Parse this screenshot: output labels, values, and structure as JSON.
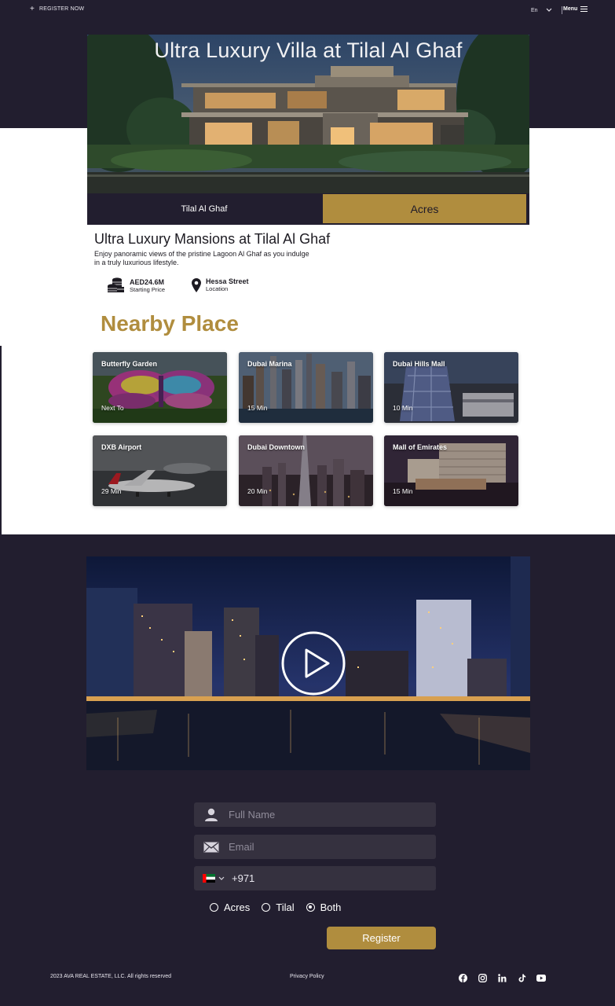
{
  "topbar": {
    "register_now": "REGISTER NOW",
    "language": "En",
    "menu": "Menu"
  },
  "hero": {
    "title": "Ultra Luxury Villa at Tilal Al Ghaf"
  },
  "tabs": {
    "left": "Tilal Al Ghaf",
    "right": "Acres"
  },
  "intro": {
    "heading": "Ultra Luxury Mansions at Tilal Al Ghaf",
    "description": "Enjoy panoramic views of the pristine Lagoon Al Ghaf as you indulge in a truly luxurious lifestyle.",
    "price_value": "AED24.6M",
    "price_label": "Starting Price",
    "location_value": "Hessa Street",
    "location_label": "Location"
  },
  "nearby": {
    "title": "Nearby Place",
    "places": [
      {
        "name": "Butterfly Garden",
        "time": "Next To"
      },
      {
        "name": "Dubai Marina",
        "time": "15 Min"
      },
      {
        "name": "Dubai Hills Mall",
        "time": "10 Min"
      },
      {
        "name": "DXB Airport",
        "time": "29 Min"
      },
      {
        "name": "Dubai Downtown",
        "time": "20 Min"
      },
      {
        "name": "Mall of Emirates",
        "time": "15 Min"
      }
    ]
  },
  "form": {
    "name_placeholder": "Full Name",
    "email_placeholder": "Email",
    "phone_code": "+971",
    "options": [
      {
        "label": "Acres",
        "selected": false
      },
      {
        "label": "Tilal",
        "selected": false
      },
      {
        "label": "Both",
        "selected": true
      }
    ],
    "submit": "Register"
  },
  "footer": {
    "copyright": "2023 AVA REAL ESTATE, LLC. All rights reserved",
    "privacy": "Privacy Policy",
    "socials": [
      "facebook-icon",
      "instagram-icon",
      "linkedin-icon",
      "tiktok-icon",
      "youtube-icon"
    ]
  },
  "colors": {
    "dark": "#221e2f",
    "gold": "#b08d3e",
    "field": "#35313f"
  }
}
